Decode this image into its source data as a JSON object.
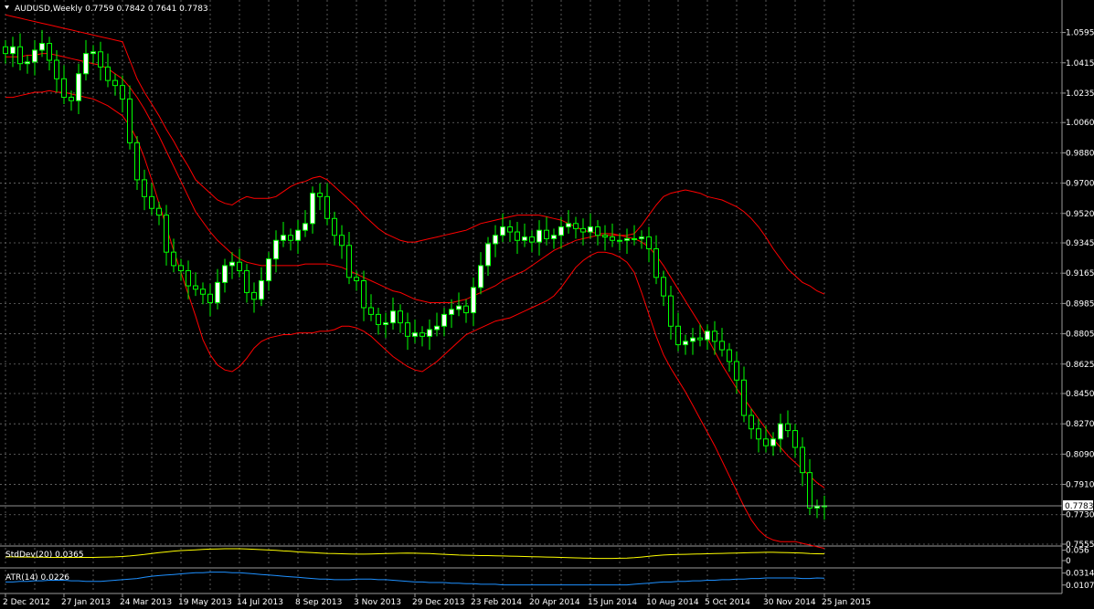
{
  "symbol_info": "AUDUSD,Weekly  0.7759 0.7842 0.7641 0.7783",
  "colors": {
    "background": "#000000",
    "grid": "#6e6e6e",
    "bull_body": "#ffffff",
    "bear_body": "#000000",
    "candle_outline": "#00ff00",
    "bands": "#ff0000",
    "stddev_line": "#ffff00",
    "atr_line": "#1e90ff",
    "text": "#ffffff"
  },
  "chart_data": [
    {
      "type": "candlestick",
      "title": "AUDUSD,Weekly  0.7759 0.7842 0.7641 0.7783",
      "ylim": [
        0.7555,
        1.0685
      ],
      "y_ticks": [
        "1.0595",
        "1.0415",
        "1.0235",
        "1.0060",
        "0.9880",
        "0.9700",
        "0.9520",
        "0.9345",
        "0.9165",
        "0.8985",
        "0.8805",
        "0.8625",
        "0.8450",
        "0.8270",
        "0.8090",
        "0.7910",
        "0.7730",
        "0.7555"
      ],
      "current_price": "0.7783",
      "x_labels": [
        "2 Dec 2012",
        "27 Jan 2013",
        "24 Mar 2013",
        "19 May 2013",
        "14 Jul 2013",
        "8 Sep 2013",
        "3 Nov 2013",
        "29 Dec 2013",
        "23 Feb 2014",
        "20 Apr 2014",
        "15 Jun 2014",
        "10 Aug 2014",
        "5 Oct 2014",
        "30 Nov 2014",
        "25 Jan 2015"
      ],
      "x_label_index": [
        0,
        8,
        16,
        24,
        32,
        40,
        48,
        56,
        64,
        72,
        80,
        88,
        96,
        104,
        112
      ],
      "close": [
        1.047,
        1.051,
        1.041,
        1.042,
        1.049,
        1.053,
        1.043,
        1.032,
        1.021,
        1.019,
        1.035,
        1.047,
        1.048,
        1.039,
        1.031,
        1.028,
        1.02,
        0.994,
        0.972,
        0.962,
        0.955,
        0.951,
        0.929,
        0.921,
        0.918,
        0.909,
        0.907,
        0.904,
        0.899,
        0.911,
        0.921,
        0.923,
        0.918,
        0.905,
        0.901,
        0.912,
        0.925,
        0.936,
        0.939,
        0.936,
        0.942,
        0.946,
        0.964,
        0.962,
        0.949,
        0.939,
        0.933,
        0.914,
        0.912,
        0.896,
        0.892,
        0.886,
        0.887,
        0.894,
        0.887,
        0.879,
        0.881,
        0.879,
        0.883,
        0.885,
        0.892,
        0.895,
        0.897,
        0.893,
        0.908,
        0.921,
        0.934,
        0.939,
        0.944,
        0.941,
        0.936,
        0.938,
        0.935,
        0.942,
        0.937,
        0.939,
        0.944,
        0.946,
        0.943,
        0.941,
        0.944,
        0.939,
        0.938,
        0.936,
        0.936,
        0.937,
        0.937,
        0.938,
        0.931,
        0.914,
        0.903,
        0.885,
        0.874,
        0.876,
        0.878,
        0.877,
        0.882,
        0.876,
        0.871,
        0.864,
        0.853,
        0.832,
        0.824,
        0.818,
        0.814,
        0.818,
        0.827,
        0.823,
        0.813,
        0.798,
        0.777,
        0.778,
        0.7783
      ],
      "series": [
        {
          "name": "Bollinger Bands upper",
          "values": [
            1.07,
            1.069,
            1.068,
            1.067,
            1.066,
            1.065,
            1.064,
            1.063,
            1.062,
            1.061,
            1.06,
            1.059,
            1.058,
            1.057,
            1.056,
            1.055,
            1.054,
            1.043,
            1.032,
            1.024,
            1.017,
            1.01,
            1.002,
            0.995,
            0.987,
            0.98,
            0.972,
            0.968,
            0.964,
            0.96,
            0.958,
            0.957,
            0.96,
            0.962,
            0.961,
            0.961,
            0.961,
            0.962,
            0.965,
            0.968,
            0.97,
            0.971,
            0.973,
            0.974,
            0.972,
            0.968,
            0.964,
            0.96,
            0.956,
            0.951,
            0.947,
            0.943,
            0.94,
            0.938,
            0.936,
            0.935,
            0.935,
            0.936,
            0.937,
            0.938,
            0.939,
            0.94,
            0.941,
            0.942,
            0.944,
            0.946,
            0.947,
            0.948,
            0.949,
            0.95,
            0.951,
            0.951,
            0.951,
            0.951,
            0.95,
            0.949,
            0.948,
            0.946,
            0.944,
            0.942,
            0.941,
            0.94,
            0.94,
            0.94,
            0.939,
            0.939,
            0.94,
            0.945,
            0.951,
            0.957,
            0.962,
            0.964,
            0.965,
            0.966,
            0.965,
            0.964,
            0.962,
            0.961,
            0.96,
            0.958,
            0.956,
            0.953,
            0.949,
            0.944,
            0.938,
            0.931,
            0.925,
            0.919,
            0.915,
            0.911,
            0.909,
            0.906,
            0.904
          ],
          "_": ""
        },
        {
          "name": "Bollinger Bands middle",
          "values": [
            1.045,
            1.045,
            1.045,
            1.046,
            1.046,
            1.047,
            1.047,
            1.046,
            1.045,
            1.044,
            1.043,
            1.042,
            1.041,
            1.04,
            1.038,
            1.035,
            1.032,
            1.027,
            1.021,
            1.014,
            1.006,
            0.998,
            0.989,
            0.98,
            0.971,
            0.962,
            0.953,
            0.947,
            0.941,
            0.936,
            0.932,
            0.928,
            0.925,
            0.923,
            0.922,
            0.921,
            0.921,
            0.921,
            0.921,
            0.921,
            0.921,
            0.922,
            0.922,
            0.922,
            0.922,
            0.921,
            0.92,
            0.918,
            0.916,
            0.914,
            0.912,
            0.91,
            0.908,
            0.906,
            0.905,
            0.903,
            0.901,
            0.9,
            0.899,
            0.899,
            0.899,
            0.899,
            0.9,
            0.901,
            0.903,
            0.905,
            0.907,
            0.909,
            0.912,
            0.914,
            0.916,
            0.918,
            0.921,
            0.924,
            0.927,
            0.93,
            0.932,
            0.934,
            0.936,
            0.937,
            0.938,
            0.939,
            0.939,
            0.939,
            0.939,
            0.938,
            0.937,
            0.935,
            0.932,
            0.927,
            0.921,
            0.914,
            0.907,
            0.9,
            0.893,
            0.886,
            0.878,
            0.87,
            0.862,
            0.855,
            0.848,
            0.842,
            0.836,
            0.83,
            0.824,
            0.818,
            0.813,
            0.808,
            0.804,
            0.8,
            0.796,
            0.792,
            0.789
          ],
          "_": ""
        },
        {
          "name": "Bollinger Bands lower",
          "values": [
            1.021,
            1.021,
            1.022,
            1.023,
            1.024,
            1.024,
            1.025,
            1.024,
            1.024,
            1.023,
            1.022,
            1.021,
            1.02,
            1.018,
            1.016,
            1.013,
            1.01,
            1.004,
            0.996,
            0.985,
            0.972,
            0.958,
            0.944,
            0.93,
            0.917,
            0.904,
            0.891,
            0.877,
            0.868,
            0.862,
            0.859,
            0.858,
            0.861,
            0.866,
            0.872,
            0.876,
            0.878,
            0.879,
            0.88,
            0.88,
            0.881,
            0.881,
            0.881,
            0.882,
            0.882,
            0.883,
            0.885,
            0.885,
            0.884,
            0.882,
            0.879,
            0.875,
            0.871,
            0.867,
            0.864,
            0.861,
            0.859,
            0.858,
            0.861,
            0.864,
            0.868,
            0.872,
            0.876,
            0.88,
            0.882,
            0.884,
            0.886,
            0.888,
            0.889,
            0.89,
            0.892,
            0.894,
            0.896,
            0.898,
            0.9,
            0.903,
            0.908,
            0.914,
            0.92,
            0.924,
            0.927,
            0.929,
            0.929,
            0.928,
            0.926,
            0.923,
            0.917,
            0.905,
            0.892,
            0.879,
            0.868,
            0.86,
            0.853,
            0.846,
            0.838,
            0.83,
            0.822,
            0.814,
            0.805,
            0.796,
            0.787,
            0.778,
            0.77,
            0.764,
            0.76,
            0.758,
            0.757,
            0.757,
            0.757,
            0.756,
            0.755,
            0.754,
            0.753
          ],
          "_": ""
        }
      ]
    },
    {
      "type": "line",
      "title": "StdDev(20) 0.0365",
      "y_ticks": [
        "0.056",
        "0"
      ],
      "series": [
        {
          "name": "StdDev(20)",
          "values": [
            0.02,
            0.02,
            0.019,
            0.019,
            0.018,
            0.018,
            0.017,
            0.017,
            0.017,
            0.017,
            0.017,
            0.017,
            0.017,
            0.018,
            0.019,
            0.02,
            0.022,
            0.025,
            0.029,
            0.033,
            0.038,
            0.043,
            0.047,
            0.051,
            0.054,
            0.056,
            0.058,
            0.06,
            0.062,
            0.063,
            0.064,
            0.064,
            0.064,
            0.063,
            0.061,
            0.059,
            0.057,
            0.055,
            0.052,
            0.05,
            0.047,
            0.045,
            0.043,
            0.041,
            0.039,
            0.038,
            0.037,
            0.036,
            0.035,
            0.035,
            0.036,
            0.037,
            0.038,
            0.039,
            0.04,
            0.041,
            0.04,
            0.039,
            0.038,
            0.036,
            0.034,
            0.032,
            0.03,
            0.029,
            0.028,
            0.027,
            0.027,
            0.026,
            0.025,
            0.024,
            0.023,
            0.022,
            0.021,
            0.02,
            0.019,
            0.018,
            0.017,
            0.016,
            0.015,
            0.014,
            0.013,
            0.012,
            0.012,
            0.012,
            0.013,
            0.014,
            0.016,
            0.019,
            0.023,
            0.027,
            0.03,
            0.032,
            0.033,
            0.034,
            0.035,
            0.036,
            0.037,
            0.038,
            0.039,
            0.04,
            0.041,
            0.042,
            0.043,
            0.044,
            0.045,
            0.045,
            0.044,
            0.043,
            0.042,
            0.041,
            0.038,
            0.037,
            0.0365
          ]
        }
      ]
    },
    {
      "type": "line",
      "title": "ATR(14) 0.0226",
      "y_ticks": [
        "0.0314",
        "0.0107"
      ],
      "series": [
        {
          "name": "ATR(14)",
          "values": [
            0.016,
            0.016,
            0.017,
            0.017,
            0.018,
            0.018,
            0.019,
            0.019,
            0.019,
            0.018,
            0.018,
            0.017,
            0.017,
            0.017,
            0.018,
            0.019,
            0.02,
            0.021,
            0.022,
            0.024,
            0.026,
            0.027,
            0.028,
            0.029,
            0.03,
            0.031,
            0.032,
            0.032,
            0.033,
            0.033,
            0.033,
            0.032,
            0.032,
            0.031,
            0.03,
            0.029,
            0.028,
            0.027,
            0.026,
            0.025,
            0.024,
            0.023,
            0.022,
            0.021,
            0.021,
            0.02,
            0.02,
            0.02,
            0.021,
            0.021,
            0.021,
            0.02,
            0.02,
            0.019,
            0.018,
            0.017,
            0.016,
            0.016,
            0.015,
            0.015,
            0.015,
            0.014,
            0.014,
            0.013,
            0.013,
            0.012,
            0.012,
            0.012,
            0.011,
            0.011,
            0.011,
            0.011,
            0.011,
            0.011,
            0.011,
            0.011,
            0.011,
            0.011,
            0.011,
            0.011,
            0.011,
            0.011,
            0.011,
            0.011,
            0.011,
            0.011,
            0.012,
            0.013,
            0.014,
            0.015,
            0.016,
            0.016,
            0.017,
            0.017,
            0.018,
            0.018,
            0.019,
            0.019,
            0.02,
            0.02,
            0.021,
            0.021,
            0.022,
            0.022,
            0.023,
            0.023,
            0.023,
            0.023,
            0.023,
            0.022,
            0.022,
            0.023,
            0.0226
          ]
        }
      ]
    }
  ]
}
